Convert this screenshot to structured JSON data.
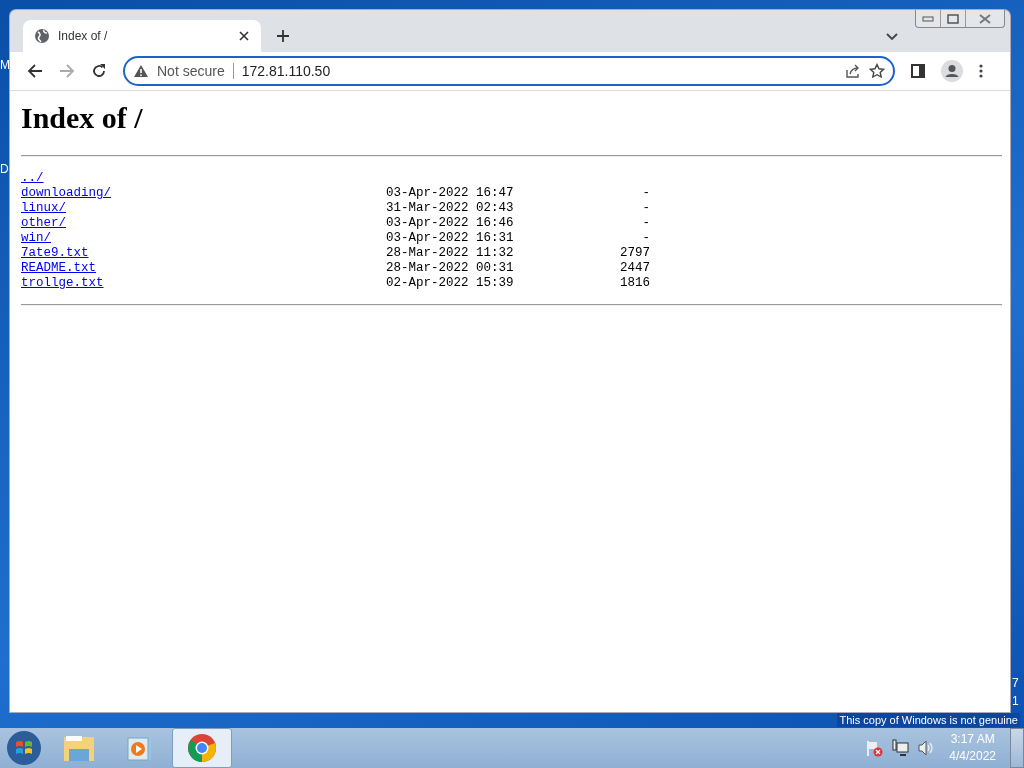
{
  "desktop": {
    "fragments": [
      {
        "text": "M"
      },
      {
        "text": "D"
      },
      {
        "text": "7"
      },
      {
        "text": "1"
      }
    ],
    "notice": "This copy of Windows is not genuine"
  },
  "browser": {
    "tabs": [
      {
        "title": "Index of /",
        "selected": true
      }
    ],
    "address": {
      "security": "Not secure",
      "url": "172.81.110.50"
    }
  },
  "page": {
    "heading": "Index of /",
    "entries": [
      {
        "name": "../"
      },
      {
        "name": "downloading/",
        "date": "03-Apr-2022 16:47",
        "size": "-"
      },
      {
        "name": "linux/",
        "date": "31-Mar-2022 02:43",
        "size": "-"
      },
      {
        "name": "other/",
        "date": "03-Apr-2022 16:46",
        "size": "-"
      },
      {
        "name": "win/",
        "date": "03-Apr-2022 16:31",
        "size": "-"
      },
      {
        "name": "7ate9.txt",
        "date": "28-Mar-2022 11:32",
        "size": "2797"
      },
      {
        "name": "README.txt",
        "date": "28-Mar-2022 00:31",
        "size": "2447"
      },
      {
        "name": "trollge.txt",
        "date": "02-Apr-2022 15:39",
        "size": "1816"
      }
    ]
  },
  "taskbar": {
    "apps": [
      {
        "kind": "explorer",
        "selected": false
      },
      {
        "kind": "media",
        "selected": false
      },
      {
        "kind": "chrome",
        "selected": true
      }
    ],
    "clock": {
      "time": "3:17 AM",
      "date": "4/4/2022"
    }
  }
}
